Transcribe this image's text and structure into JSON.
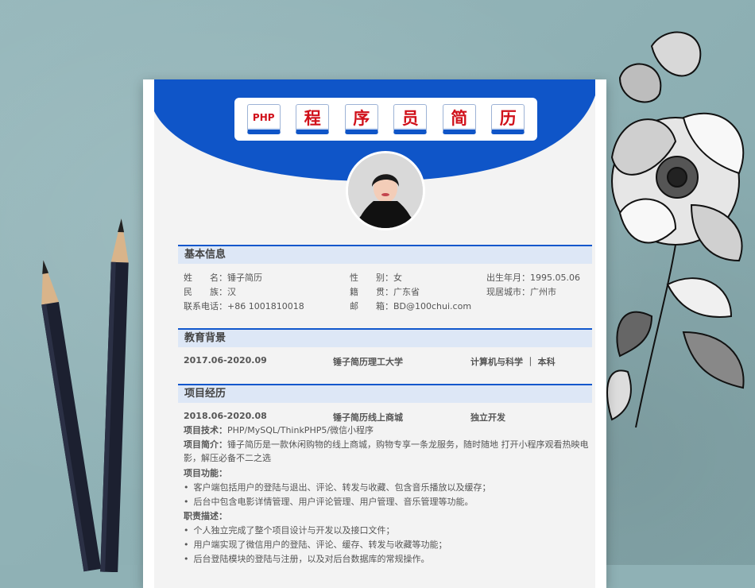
{
  "title": {
    "keys": [
      "PHP",
      "程",
      "序",
      "员",
      "简",
      "历"
    ]
  },
  "basic_info": {
    "heading": "基本信息",
    "name": "姓　　名：锤子简历",
    "gender": "性　　别：女",
    "birth": "出生年月：1995.05.06",
    "ethnicity": "民　　族：汉",
    "native": "籍　　贯：广东省",
    "city": "现居城市：广州市",
    "phone": "联系电话：+86 1001810018",
    "email": "邮　　箱：BD@100chui.com"
  },
  "education": {
    "heading": "教育背景",
    "period": "2017.06-2020.09",
    "school": "锤子简历理工大学",
    "major": "计算机与科学 ｜ 本科"
  },
  "projects": {
    "heading": "项目经历",
    "period": "2018.06-2020.08",
    "name": "锤子简历线上商城",
    "role": "独立开发",
    "tech_label": "项目技术：",
    "tech": "PHP/MySQL/ThinkPHP5/微信小程序",
    "intro_label": "项目简介：",
    "intro": "锤子简历是一款休闲购物的线上商城，购物专享一条龙服务，随时随地  打开小程序观看热映电影，解压必备不二之选",
    "func_label": "项目功能：",
    "functions": [
      "客户端包括用户的登陆与退出、评论、转发与收藏、包含音乐播放以及缓存；",
      "后台中包含电影详情管理、用户评论管理、用户管理、音乐管理等功能。"
    ],
    "duty_label": "职责描述：",
    "duties": [
      "个人独立完成了整个项目设计与开发以及接口文件；",
      "用户端实现了微信用户的登陆、评论、缓存、转发与收藏等功能；",
      "后台登陆模块的登陆与注册，以及对后台数据库的常规操作。"
    ]
  },
  "colors": {
    "accent": "#1257cc",
    "title_red": "#d0101a",
    "section_bg": "#dde7f6"
  },
  "icons": [
    "avatar-photo",
    "pencil-left",
    "pencil-right",
    "flower-illustration"
  ]
}
